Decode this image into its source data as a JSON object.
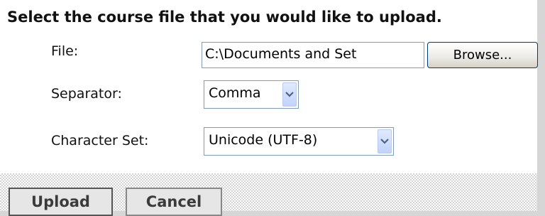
{
  "heading": "Select the course file that you would like to upload.",
  "form": {
    "file_label": "File:",
    "file_value": "C:\\Documents and Set",
    "browse_label": "Browse...",
    "separator_label": "Separator:",
    "separator_value": "Comma",
    "charset_label": "Character Set:",
    "charset_value": "Unicode (UTF-8)"
  },
  "actions": {
    "upload_label": "Upload",
    "cancel_label": "Cancel"
  },
  "icons": {
    "dropdown": "chevron-down-icon"
  },
  "colors": {
    "field_border": "#7f9db9",
    "dropdown_bg": "#c1d3fb",
    "dropdown_arrow": "#4d6185",
    "background": "#d6d6d6"
  }
}
